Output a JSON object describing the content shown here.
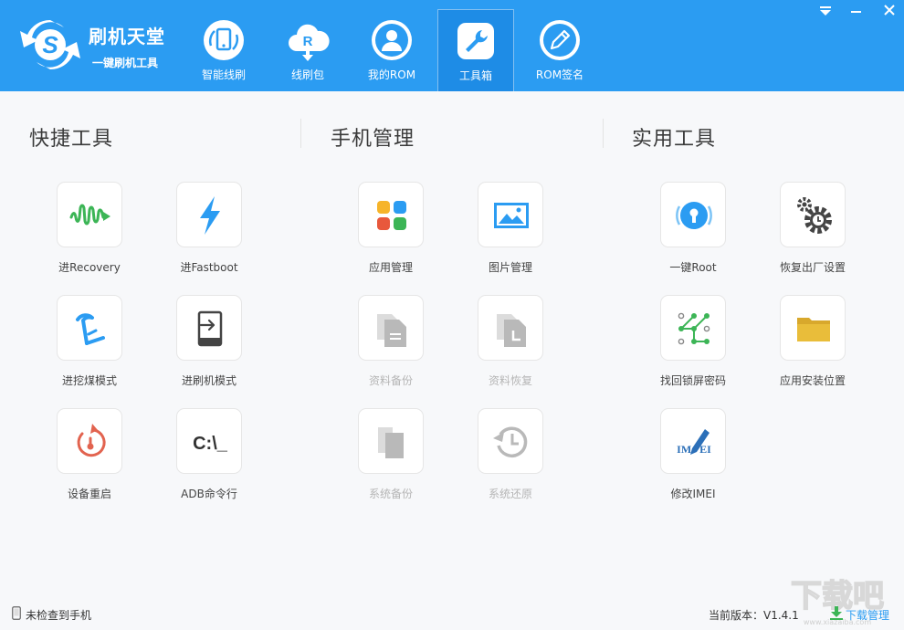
{
  "app": {
    "brand_name": "刷机天堂",
    "brand_sub": "一键刷机工具",
    "brand_color": "#2b9cf2"
  },
  "nav": {
    "tabs": [
      {
        "label": "智能线刷",
        "icon": "smart-flash-icon",
        "active": false
      },
      {
        "label": "线刷包",
        "icon": "rom-package-icon",
        "active": false
      },
      {
        "label": "我的ROM",
        "icon": "user-icon",
        "active": false
      },
      {
        "label": "工具箱",
        "icon": "wrench-icon",
        "active": true
      },
      {
        "label": "ROM签名",
        "icon": "pen-icon",
        "active": false
      }
    ]
  },
  "window": {
    "buttons": [
      "dropdown-icon",
      "minimize-icon",
      "close-icon"
    ]
  },
  "sections": [
    {
      "title": "快捷工具",
      "tools": [
        {
          "label": "进Recovery",
          "icon": "recovery-wave-icon",
          "enabled": true
        },
        {
          "label": "进Fastboot",
          "icon": "lightning-icon",
          "enabled": true
        },
        {
          "label": "进挖煤模式",
          "icon": "mining-mode-icon",
          "enabled": true
        },
        {
          "label": "进刷机模式",
          "icon": "flash-mode-icon",
          "enabled": true
        },
        {
          "label": "设备重启",
          "icon": "restart-icon",
          "enabled": true
        },
        {
          "label": "ADB命令行",
          "icon": "terminal-icon",
          "enabled": true
        }
      ]
    },
    {
      "title": "手机管理",
      "tools": [
        {
          "label": "应用管理",
          "icon": "apps-icon",
          "enabled": true
        },
        {
          "label": "图片管理",
          "icon": "image-icon",
          "enabled": true
        },
        {
          "label": "资料备份",
          "icon": "data-backup-icon",
          "enabled": false
        },
        {
          "label": "资料恢复",
          "icon": "data-restore-icon",
          "enabled": false
        },
        {
          "label": "系统备份",
          "icon": "system-backup-icon",
          "enabled": false
        },
        {
          "label": "系统还原",
          "icon": "system-restore-icon",
          "enabled": false
        }
      ]
    },
    {
      "title": "实用工具",
      "tools": [
        {
          "label": "一键Root",
          "icon": "root-lock-icon",
          "enabled": true
        },
        {
          "label": "恢复出厂设置",
          "icon": "gears-icon",
          "enabled": true
        },
        {
          "label": "找回锁屏密码",
          "icon": "pattern-lock-icon",
          "enabled": true
        },
        {
          "label": "应用安装位置",
          "icon": "folder-icon",
          "enabled": true
        },
        {
          "label": "修改IMEI",
          "icon": "imei-edit-icon",
          "enabled": true
        }
      ]
    }
  ],
  "status": {
    "device_status": "未检查到手机",
    "version": "当前版本：V1.4.1",
    "download_link": "下载管理",
    "terminal_text": "C:\\_",
    "imei_text": "IM   EI",
    "watermark_text": "下载吧",
    "watermark_url": "www.xiazaiba.com"
  }
}
